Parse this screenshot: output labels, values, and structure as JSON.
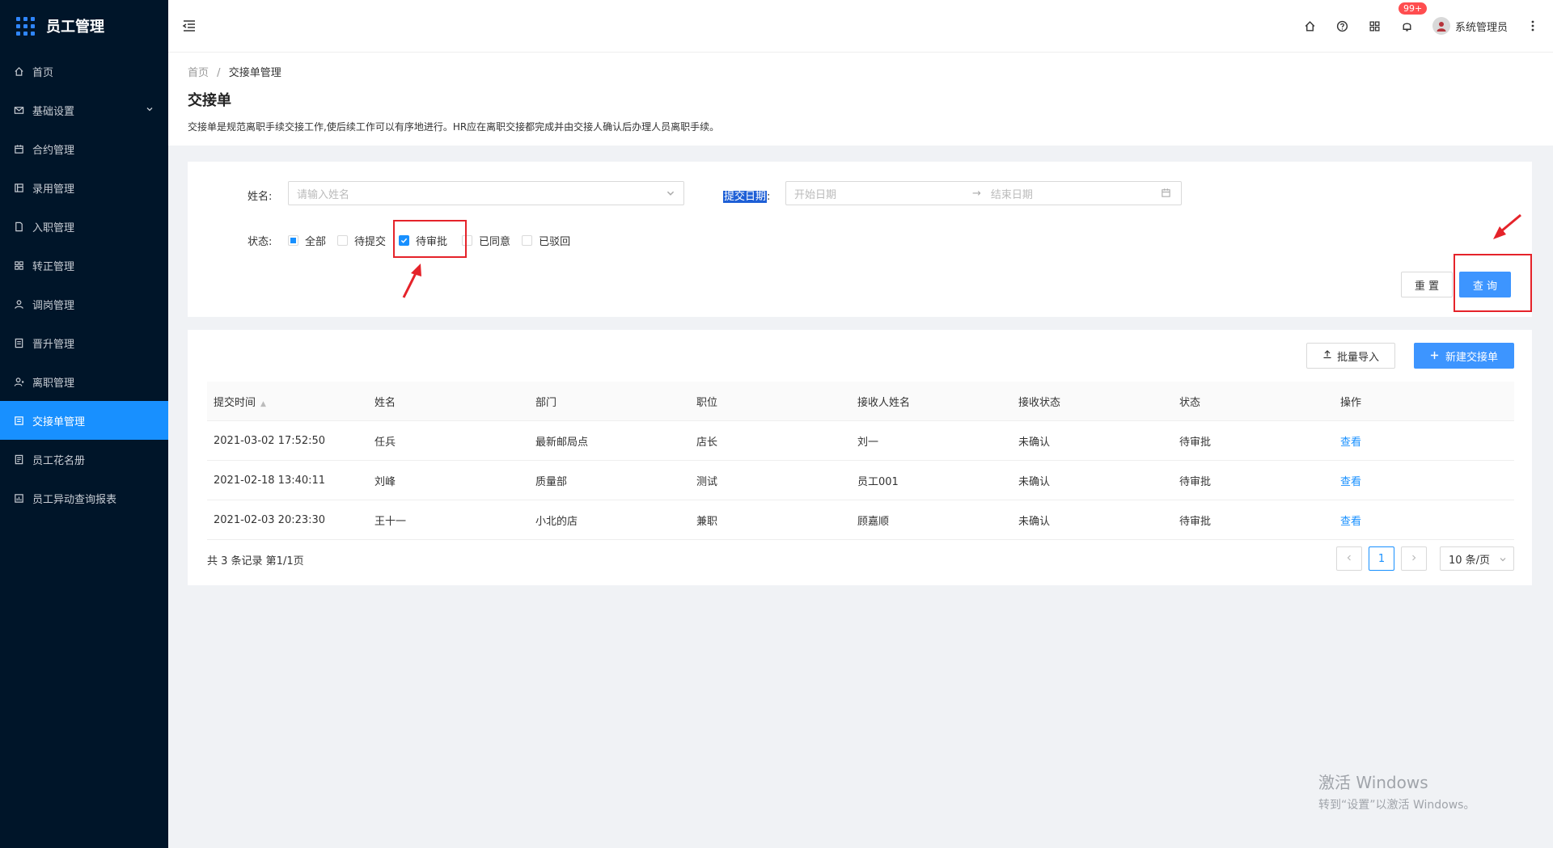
{
  "app": {
    "title": "员工管理"
  },
  "sidebar": {
    "items": [
      {
        "label": "首页",
        "icon": "home-icon"
      },
      {
        "label": "基础设置",
        "icon": "mail-icon"
      },
      {
        "label": "合约管理",
        "icon": "calendar-icon"
      },
      {
        "label": "录用管理",
        "icon": "layout-icon"
      },
      {
        "label": "入职管理",
        "icon": "file-icon"
      },
      {
        "label": "转正管理",
        "icon": "grid-icon"
      },
      {
        "label": "调岗管理",
        "icon": "user-icon"
      },
      {
        "label": "晋升管理",
        "icon": "doc-icon"
      },
      {
        "label": "离职管理",
        "icon": "user-leave-icon"
      },
      {
        "label": "交接单管理",
        "icon": "form-icon",
        "active": true
      },
      {
        "label": "员工花名册",
        "icon": "roster-icon"
      },
      {
        "label": "员工异动查询报表",
        "icon": "report-icon"
      }
    ]
  },
  "header": {
    "notification_badge": "99+",
    "user_name": "系统管理员"
  },
  "breadcrumb": {
    "home": "首页",
    "separator": "/",
    "current": "交接单管理"
  },
  "page": {
    "title": "交接单",
    "description": "交接单是规范离职手续交接工作,使后续工作可以有序地进行。HR应在离职交接都完成并由交接人确认后办理人员离职手续。"
  },
  "filter": {
    "name_label": "姓名:",
    "name_placeholder": "请输入姓名",
    "date_label": "提交日期",
    "date_colon": ":",
    "start_placeholder": "开始日期",
    "arrow": "→",
    "end_placeholder": "结束日期",
    "status_label": "状态:",
    "statuses": [
      {
        "label": "全部",
        "state": "indeterminate"
      },
      {
        "label": "待提交",
        "state": "unchecked"
      },
      {
        "label": "待审批",
        "state": "checked"
      },
      {
        "label": "已同意",
        "state": "unchecked"
      },
      {
        "label": "已驳回",
        "state": "unchecked"
      }
    ],
    "reset_label": "重 置",
    "query_label": "查 询"
  },
  "table": {
    "import_label": "批量导入",
    "new_label": "新建交接单",
    "columns": [
      "提交时间",
      "姓名",
      "部门",
      "职位",
      "接收人姓名",
      "接收状态",
      "状态",
      "操作"
    ],
    "rows": [
      [
        "2021-03-02 17:52:50",
        "任兵",
        "最新邮局点",
        "店长",
        "刘一",
        "未确认",
        "待审批",
        "查看"
      ],
      [
        "2021-02-18 13:40:11",
        "刘峰",
        "质量部",
        "测试",
        "员工001",
        "未确认",
        "待审批",
        "查看"
      ],
      [
        "2021-02-03 20:23:30",
        "王十一",
        "小北的店",
        "兼职",
        "顾嘉顺",
        "未确认",
        "待审批",
        "查看"
      ]
    ],
    "total": "共 3 条记录 第1/1页",
    "current_page": "1",
    "page_size": "10 条/页"
  },
  "watermark": {
    "line1": "激活 Windows",
    "line2": "转到“设置”以激活 Windows。"
  },
  "colors": {
    "sidebar_bg": "#001529",
    "primary": "#1890ff",
    "annotation_red": "#e5232a"
  }
}
